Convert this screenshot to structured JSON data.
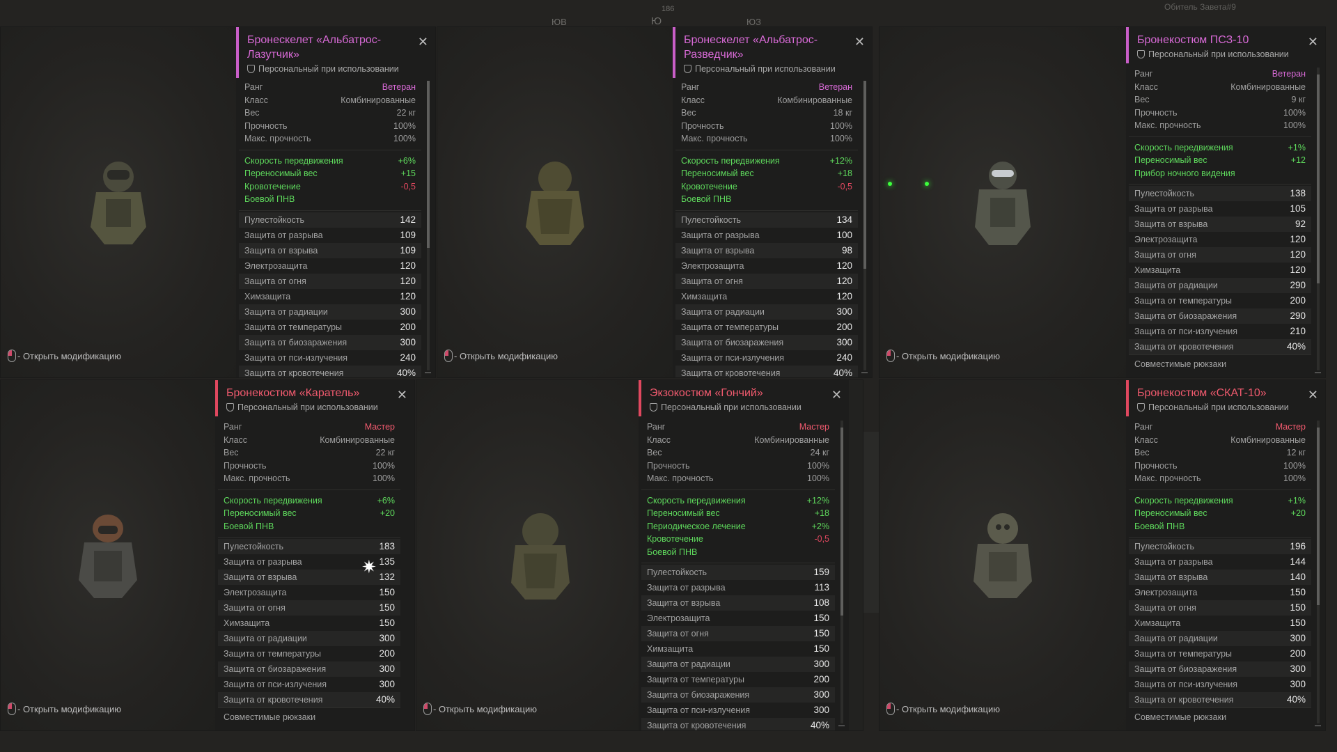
{
  "hud": {
    "compass": [
      "ЮВ",
      "Ю",
      "ЮЗ"
    ],
    "bearing": "186",
    "location": "Обитель Завета#9"
  },
  "open_mod_label": "- Открыть модификацию",
  "colors": {
    "veteran": "#d86ad6",
    "master": "#f05a6e",
    "bonus": "#5ed85c",
    "penalty": "#e0485f"
  },
  "info_labels": [
    "Ранг",
    "Класс",
    "Вес",
    "Прочность",
    "Макс. прочность"
  ],
  "prot_labels": [
    "Пулестойкость",
    "Защита от разрыва",
    "Защита от взрыва",
    "Электрозащита",
    "Защита от огня",
    "Химзащита",
    "Защита от радиации",
    "Защита от температуры",
    "Защита от биозаражения",
    "Защита от пси-излучения",
    "Защита от кровотечения"
  ],
  "items": [
    {
      "title": "Бронескелет «Альбатрос-Лазутчик»",
      "subtitle": "Персональный при использовании",
      "rank": "Ветеран",
      "class": "Комбинированные",
      "weight": "22 кг",
      "durability": "100%",
      "max_durability": "100%",
      "bonuses": [
        {
          "label": "Скорость передвижения",
          "value": "+6%"
        },
        {
          "label": "Переносимый вес",
          "value": "+15"
        },
        {
          "label": "Кровотечение",
          "value": "-0,5"
        },
        {
          "label": "Боевой ПНВ",
          "value": ""
        }
      ],
      "prot": [
        "142",
        "109",
        "109",
        "120",
        "120",
        "120",
        "300",
        "200",
        "300",
        "240",
        "40%"
      ],
      "extra": ""
    },
    {
      "title": "Бронескелет «Альбатрос-Разведчик»",
      "subtitle": "Персональный при использовании",
      "rank": "Ветеран",
      "class": "Комбинированные",
      "weight": "18 кг",
      "durability": "100%",
      "max_durability": "100%",
      "bonuses": [
        {
          "label": "Скорость передвижения",
          "value": "+12%"
        },
        {
          "label": "Переносимый вес",
          "value": "+18"
        },
        {
          "label": "Кровотечение",
          "value": "-0,5"
        },
        {
          "label": "Боевой ПНВ",
          "value": ""
        }
      ],
      "prot": [
        "134",
        "100",
        "98",
        "120",
        "120",
        "120",
        "300",
        "200",
        "300",
        "240",
        "40%"
      ],
      "extra": ""
    },
    {
      "title": "Бронекостюм ПСЗ-10",
      "subtitle": "Персональный при использовании",
      "rank": "Ветеран",
      "class": "Комбинированные",
      "weight": "9 кг",
      "durability": "100%",
      "max_durability": "100%",
      "bonuses": [
        {
          "label": "Скорость передвижения",
          "value": "+1%"
        },
        {
          "label": "Переносимый вес",
          "value": "+12"
        },
        {
          "label": "Прибор ночного видения",
          "value": ""
        }
      ],
      "prot": [
        "138",
        "105",
        "92",
        "120",
        "120",
        "120",
        "290",
        "200",
        "290",
        "210",
        "40%"
      ],
      "extra": "Совместимые рюкзаки"
    },
    {
      "title": "Бронекостюм «Каратель»",
      "subtitle": "Персональный при использовании",
      "rank": "Мастер",
      "class": "Комбинированные",
      "weight": "22 кг",
      "durability": "100%",
      "max_durability": "100%",
      "bonuses": [
        {
          "label": "Скорость передвижения",
          "value": "+6%"
        },
        {
          "label": "Переносимый вес",
          "value": "+20"
        },
        {
          "label": "Боевой ПНВ",
          "value": ""
        }
      ],
      "prot": [
        "183",
        "135",
        "132",
        "150",
        "150",
        "150",
        "300",
        "200",
        "300",
        "300",
        "40%"
      ],
      "extra": "Совместимые рюкзаки"
    },
    {
      "title": "Экзокостюм «Гончий»",
      "subtitle": "Персональный при использовании",
      "rank": "Мастер",
      "class": "Комбинированные",
      "weight": "24 кг",
      "durability": "100%",
      "max_durability": "100%",
      "bonuses": [
        {
          "label": "Скорость передвижения",
          "value": "+12%"
        },
        {
          "label": "Переносимый вес",
          "value": "+18"
        },
        {
          "label": "Периодическое лечение",
          "value": "+2%"
        },
        {
          "label": "Кровотечение",
          "value": "-0,5"
        },
        {
          "label": "Боевой ПНВ",
          "value": ""
        }
      ],
      "prot": [
        "159",
        "113",
        "108",
        "150",
        "150",
        "150",
        "300",
        "200",
        "300",
        "300",
        "40%"
      ],
      "extra": ""
    },
    {
      "title": "Бронекостюм «СКАТ-10»",
      "subtitle": "Персональный при использовании",
      "rank": "Мастер",
      "class": "Комбинированные",
      "weight": "12 кг",
      "durability": "100%",
      "max_durability": "100%",
      "bonuses": [
        {
          "label": "Скорость передвижения",
          "value": "+1%"
        },
        {
          "label": "Переносимый вес",
          "value": "+20"
        },
        {
          "label": "Боевой ПНВ",
          "value": ""
        }
      ],
      "prot": [
        "196",
        "144",
        "140",
        "150",
        "150",
        "150",
        "300",
        "200",
        "300",
        "300",
        "40%"
      ],
      "extra": "Совместимые рюкзаки"
    }
  ]
}
